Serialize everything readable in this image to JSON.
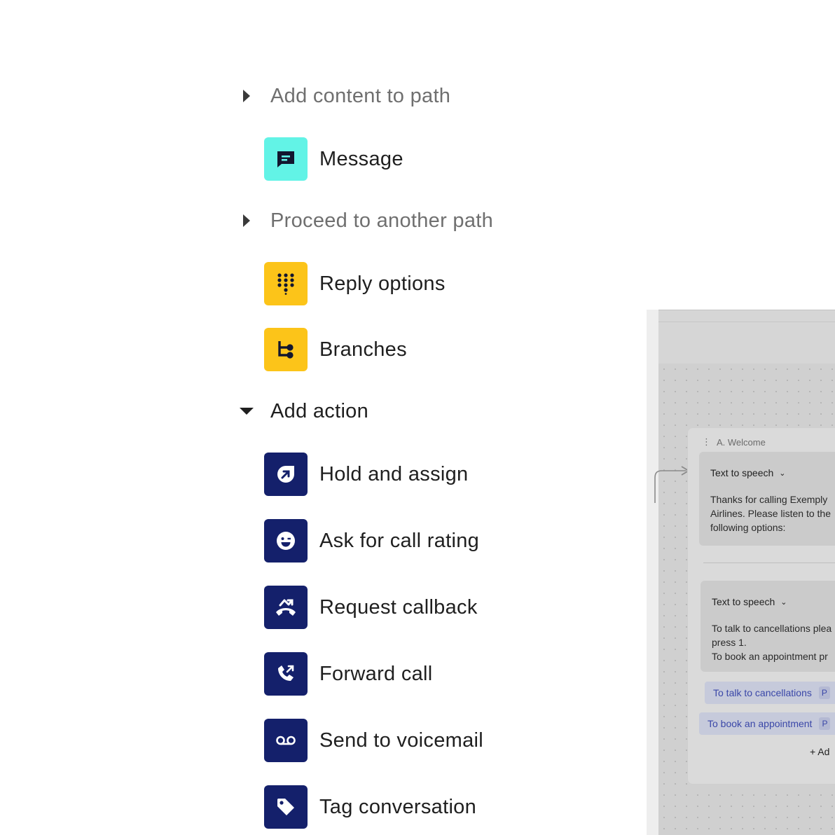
{
  "menu": {
    "sections": [
      {
        "label": "Add content to path",
        "state": "collapsed",
        "items": [
          {
            "label": "Message",
            "icon": "message-icon",
            "color": "#62f3e6"
          }
        ]
      },
      {
        "label": "Proceed to another path",
        "state": "collapsed",
        "items": [
          {
            "label": "Reply options",
            "icon": "dialpad-icon",
            "color": "#fcc419"
          },
          {
            "label": "Branches",
            "icon": "branches-icon",
            "color": "#fcc419"
          }
        ]
      },
      {
        "label": "Add action",
        "state": "expanded",
        "items": [
          {
            "label": "Hold and assign",
            "icon": "hold-assign-icon",
            "color": "#14206b"
          },
          {
            "label": "Ask for call rating",
            "icon": "rating-smile-icon",
            "color": "#14206b"
          },
          {
            "label": "Request callback",
            "icon": "callback-icon",
            "color": "#14206b"
          },
          {
            "label": "Forward call",
            "icon": "forward-call-icon",
            "color": "#14206b"
          },
          {
            "label": "Send to voicemail",
            "icon": "voicemail-icon",
            "color": "#14206b"
          },
          {
            "label": "Tag conversation",
            "icon": "tag-icon",
            "color": "#14206b"
          }
        ]
      }
    ]
  },
  "canvas": {
    "node": {
      "title": "A. Welcome",
      "cards": [
        {
          "title": "Text to speech",
          "body": "Thanks for calling Exemply\nAirlines. Please listen to the\nfollowing options:"
        },
        {
          "title": "Text to speech",
          "body": "To talk to cancellations plea\npress 1.\nTo book an appointment pr"
        }
      ],
      "options": [
        {
          "label": "To talk to cancellations",
          "tag": "P"
        },
        {
          "label": "To book an appointment",
          "tag": "P"
        }
      ],
      "add_label": "+ Ad"
    }
  },
  "colors": {
    "cyan": "#62f3e6",
    "yellow": "#fcc419",
    "navy": "#14206b",
    "muted_text": "#6f6f6f"
  }
}
